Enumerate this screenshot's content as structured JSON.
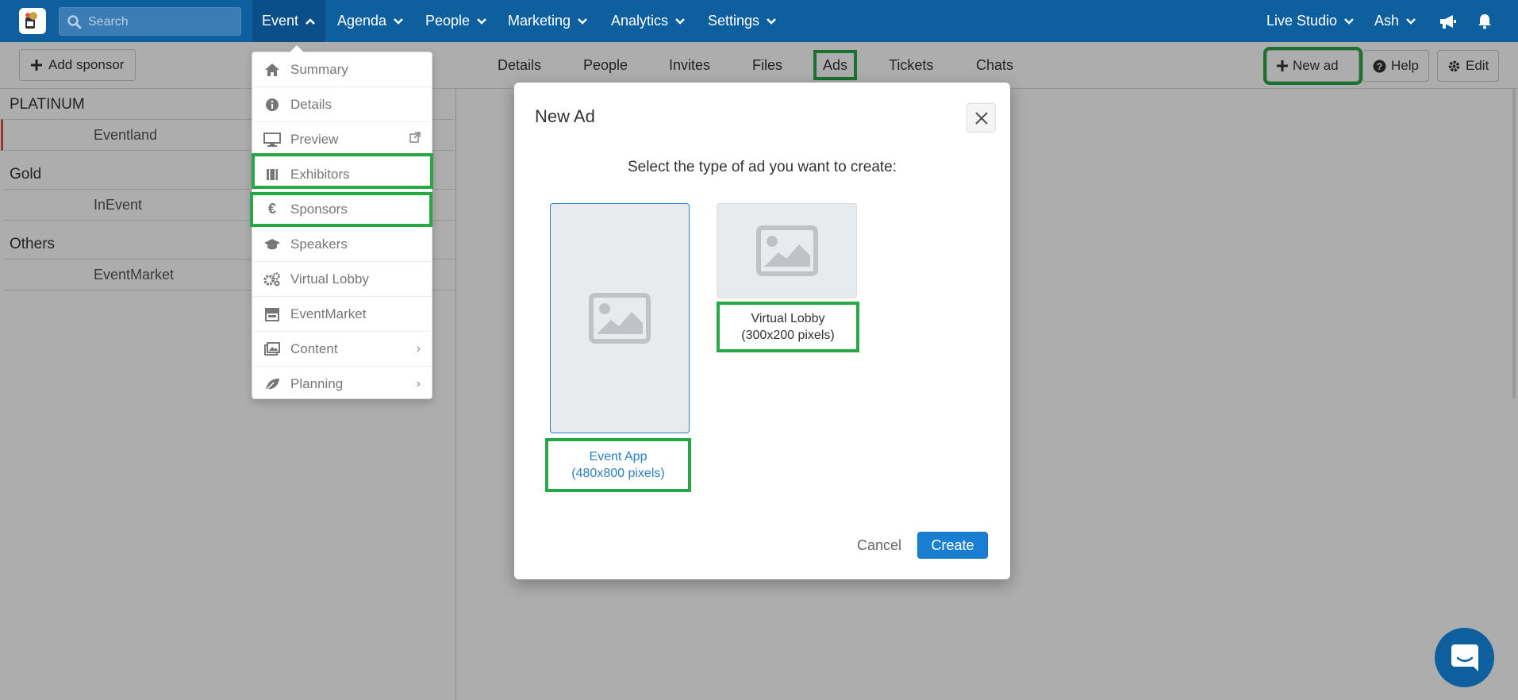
{
  "navbar": {
    "search_placeholder": "Search",
    "items": [
      {
        "label": "Event",
        "active": true
      },
      {
        "label": "Agenda"
      },
      {
        "label": "People"
      },
      {
        "label": "Marketing"
      },
      {
        "label": "Analytics"
      },
      {
        "label": "Settings"
      }
    ],
    "right_items": [
      {
        "label": "Live Studio"
      },
      {
        "label": "Ash"
      }
    ]
  },
  "toolbar": {
    "add_sponsor_label": "Add sponsor"
  },
  "sponsors": {
    "groups": [
      {
        "title": "PLATINUM",
        "items": [
          "Eventland"
        ]
      },
      {
        "title": "Gold",
        "items": [
          "InEvent"
        ]
      },
      {
        "title": "Others",
        "items": [
          "EventMarket"
        ]
      }
    ]
  },
  "tabs": [
    "Details",
    "People",
    "Invites",
    "Files",
    "Ads",
    "Tickets",
    "Chats"
  ],
  "actions": {
    "new_ad": "New ad",
    "help": "Help",
    "edit": "Edit"
  },
  "event_menu": {
    "items": [
      {
        "label": "Summary",
        "icon": "home-icon"
      },
      {
        "label": "Details",
        "icon": "info-icon"
      },
      {
        "label": "Preview",
        "icon": "monitor-icon",
        "trail": "external-link-icon"
      },
      {
        "label": "Exhibitors",
        "icon": "book-icon"
      },
      {
        "label": "Sponsors",
        "icon": "euro-icon"
      },
      {
        "label": "Speakers",
        "icon": "graduation-cap-icon"
      },
      {
        "label": "Virtual Lobby",
        "icon": "gears-icon"
      },
      {
        "label": "EventMarket",
        "icon": "store-icon"
      },
      {
        "label": "Content",
        "icon": "images-icon",
        "trail": "chevron-right-icon"
      },
      {
        "label": "Planning",
        "icon": "leaf-icon",
        "trail": "chevron-right-icon"
      }
    ]
  },
  "modal": {
    "title": "New Ad",
    "prompt": "Select the type of ad you want to create:",
    "options": [
      {
        "name": "Event App",
        "size": "(480x800 pixels)",
        "selected": true
      },
      {
        "name": "Virtual Lobby",
        "size": "(300x200 pixels)",
        "selected": false
      }
    ],
    "cancel_label": "Cancel",
    "create_label": "Create"
  },
  "colors": {
    "navbar": "#0e5f9e",
    "highlight": "#28a745",
    "primary": "#1a7fd1",
    "selected_border": "#2a7fc5"
  }
}
